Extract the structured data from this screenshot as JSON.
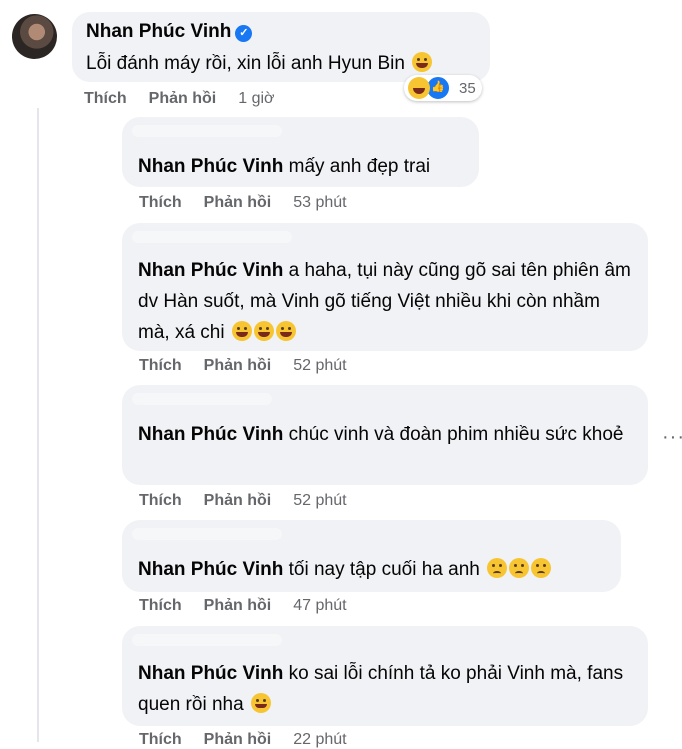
{
  "post_comment": {
    "author": "Nhan Phúc Vinh",
    "text": "Lỗi đánh máy rồi, xin lỗi anh Hyun Bin",
    "like_label": "Thích",
    "reply_label": "Phản hồi",
    "time": "1 giờ",
    "reaction_count": "35"
  },
  "replies": [
    {
      "author": "Nhan Phúc Vinh",
      "text": "mấy anh đẹp trai",
      "like_label": "Thích",
      "reply_label": "Phản hồi",
      "time": "53 phút"
    },
    {
      "author": "Nhan Phúc Vinh",
      "text": "a haha, tụi này cũng gõ sai tên phiên âm dv Hàn suốt, mà Vinh gõ tiếng Việt nhiều khi còn nhầm mà, xá chi",
      "like_label": "Thích",
      "reply_label": "Phản hồi",
      "time": "52 phút"
    },
    {
      "author": "Nhan Phúc Vinh",
      "text": "chúc vinh và đoàn phim nhiều sức khoẻ",
      "like_label": "Thích",
      "reply_label": "Phản hồi",
      "time": "52 phút"
    },
    {
      "author": "Nhan Phúc Vinh",
      "text": "tối nay tập cuối ha anh",
      "like_label": "Thích",
      "reply_label": "Phản hồi",
      "time": "47 phút"
    },
    {
      "author": "Nhan Phúc Vinh",
      "text": "ko sai lỗi chính tả ko phải Vinh mà, fans quen rồi nha",
      "like_label": "Thích",
      "reply_label": "Phản hồi",
      "time": "22 phút"
    }
  ],
  "colors": {
    "bubble": "#f0f2f5",
    "meta": "#65676b",
    "verified": "#1877f2"
  }
}
